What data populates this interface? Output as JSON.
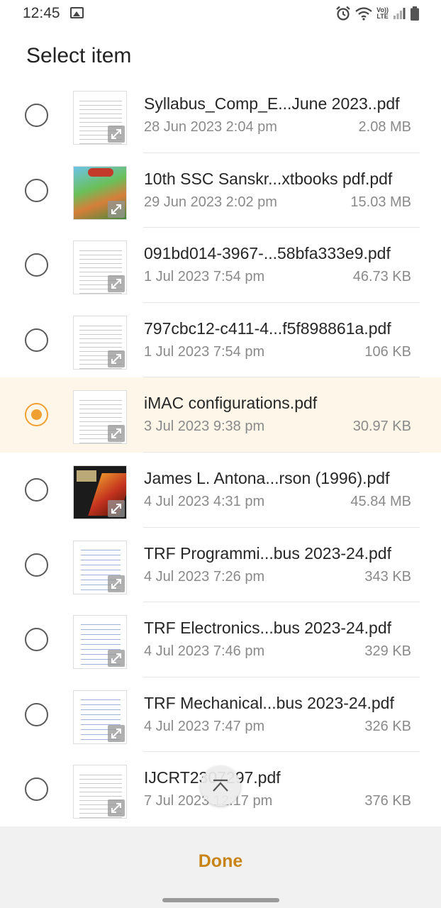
{
  "status_bar": {
    "time": "12:45",
    "icons": [
      "gallery-icon",
      "alarm-icon",
      "wifi-icon",
      "volte-icon",
      "signal-icon",
      "battery-icon"
    ],
    "volte_label_1": "Vo))",
    "volte_label_2": "LTE"
  },
  "header": {
    "title": "Select item"
  },
  "accent_color": "#f0a030",
  "files": [
    {
      "name": "Syllabus_Comp_E...June 2023..pdf",
      "date": "28 Jun 2023 2:04 pm",
      "size": "2.08 MB",
      "selected": false,
      "thumb": "doc"
    },
    {
      "name": "10th SSC Sanskr...xtbooks pdf.pdf",
      "date": "29 Jun 2023 2:02 pm",
      "size": "15.03 MB",
      "selected": false,
      "thumb": "art"
    },
    {
      "name": "091bd014-3967-...58bfa333e9.pdf",
      "date": "1 Jul 2023 7:54 pm",
      "size": "46.73 KB",
      "selected": false,
      "thumb": "doc"
    },
    {
      "name": "797cbc12-c411-4...f5f898861a.pdf",
      "date": "1 Jul 2023 7:54 pm",
      "size": "106 KB",
      "selected": false,
      "thumb": "doc"
    },
    {
      "name": "iMAC configurations.pdf",
      "date": "3 Jul 2023 9:38 pm",
      "size": "30.97 KB",
      "selected": true,
      "thumb": "doc"
    },
    {
      "name": "James L. Antona...rson (1996).pdf",
      "date": "4 Jul 2023 4:31 pm",
      "size": "45.84 MB",
      "selected": false,
      "thumb": "book"
    },
    {
      "name": "TRF Programmi...bus 2023-24.pdf",
      "date": "4 Jul 2023 7:26 pm",
      "size": "343 KB",
      "selected": false,
      "thumb": "blue"
    },
    {
      "name": "TRF Electronics...bus 2023-24.pdf",
      "date": "4 Jul 2023 7:46 pm",
      "size": "329 KB",
      "selected": false,
      "thumb": "blue"
    },
    {
      "name": "TRF Mechanical...bus 2023-24.pdf",
      "date": "4 Jul 2023 7:47 pm",
      "size": "326 KB",
      "selected": false,
      "thumb": "blue"
    },
    {
      "name": "IJCRT2307297.pdf",
      "date": "7 Jul 2023 12:17 pm",
      "size": "376 KB",
      "selected": false,
      "thumb": "doc"
    }
  ],
  "scroll_top_icon": "chevron-up-icon",
  "footer": {
    "done_label": "Done"
  }
}
